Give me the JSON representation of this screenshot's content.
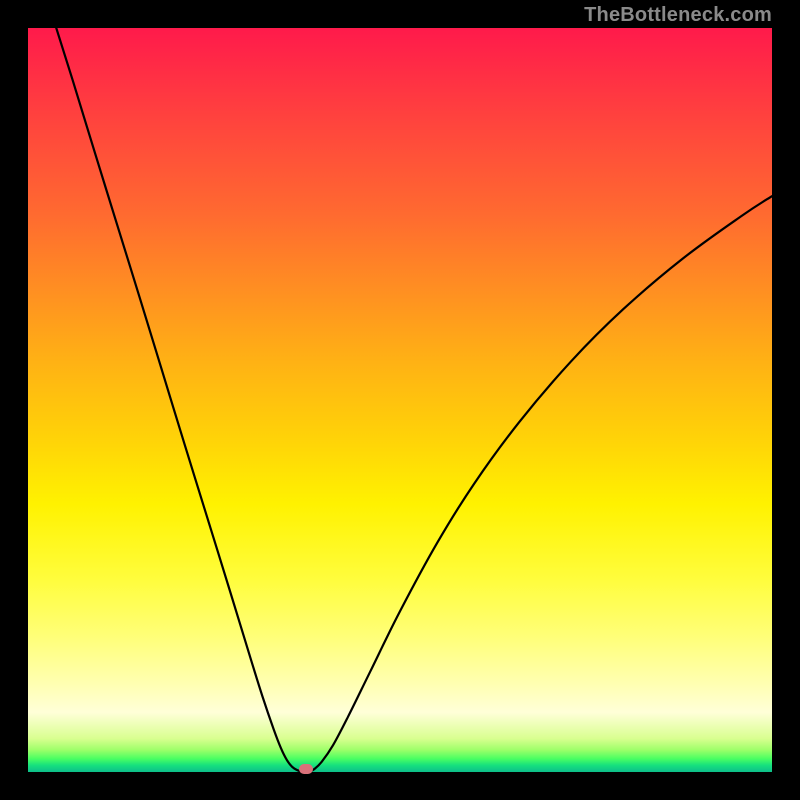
{
  "watermark": {
    "text": "TheBottleneck.com"
  },
  "colors": {
    "curve_stroke": "#000000",
    "marker_fill": "#d9717a",
    "bg": "#000000"
  },
  "chart_data": {
    "type": "line",
    "title": "",
    "xlabel": "",
    "ylabel": "",
    "xlim": [
      0,
      100
    ],
    "ylim": [
      0,
      100
    ],
    "grid": false,
    "legend": false,
    "series": [
      {
        "name": "bottleneck-curve-left",
        "x": [
          3.8,
          6,
          9,
          12,
          15,
          18,
          21,
          24,
          27,
          30,
          31.5,
          33,
          34,
          34.8,
          35.5,
          36.2,
          36.8,
          37.3
        ],
        "y": [
          100,
          93,
          83.2,
          73.5,
          63.8,
          54,
          44.2,
          34.5,
          24.8,
          15,
          10.2,
          5.8,
          3.2,
          1.6,
          0.7,
          0.25,
          0.05,
          0
        ]
      },
      {
        "name": "bottleneck-curve-right",
        "x": [
          37.3,
          37.8,
          38.5,
          39.5,
          41,
          43,
          46,
          50,
          55,
          60,
          66,
          73,
          80,
          88,
          96,
          100
        ],
        "y": [
          0,
          0.05,
          0.4,
          1.4,
          3.6,
          7.4,
          13.5,
          21.6,
          30.8,
          38.8,
          47.0,
          55.2,
          62.2,
          69.0,
          74.8,
          77.4
        ]
      }
    ],
    "marker": {
      "x": 37.3,
      "y": 0.4,
      "name": "optimal-point"
    }
  }
}
